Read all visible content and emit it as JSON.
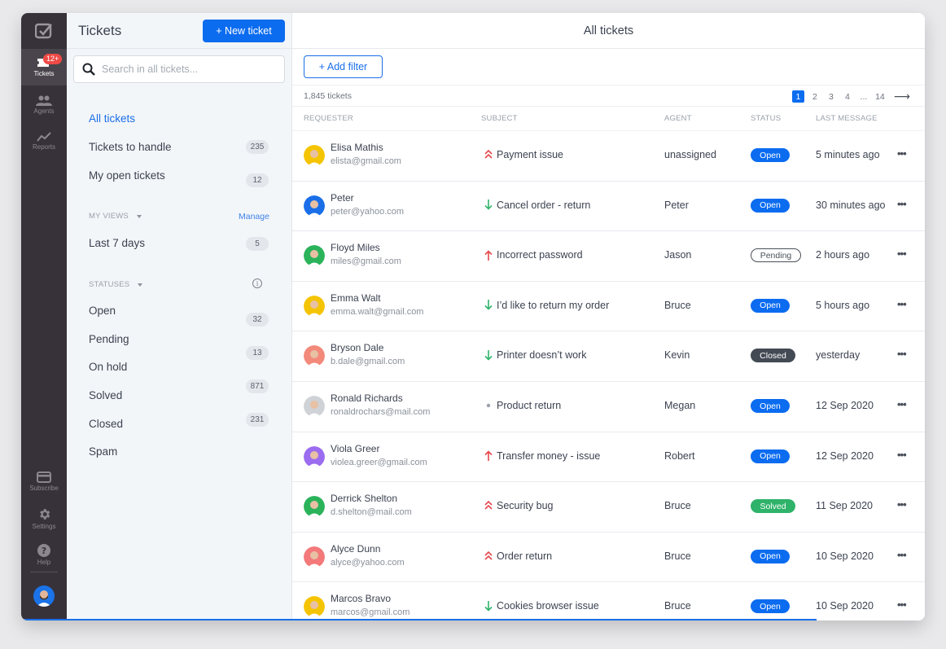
{
  "rail": {
    "items": [
      {
        "name": "tickets",
        "label": "Tickets",
        "icon": "tickets-icon",
        "badge": "12+",
        "active": true
      },
      {
        "name": "agents",
        "label": "Agents",
        "icon": "agents-icon"
      },
      {
        "name": "reports",
        "label": "Reports",
        "icon": "reports-icon"
      },
      {
        "name": "subscribe",
        "label": "Subscribe",
        "icon": "card-icon"
      },
      {
        "name": "settings",
        "label": "Settings",
        "icon": "gear-icon"
      },
      {
        "name": "help",
        "label": "Help",
        "icon": "help-icon"
      }
    ]
  },
  "panel": {
    "title": "Tickets",
    "new_ticket_label": "+ New ticket",
    "search_placeholder": "Search in all tickets...",
    "views": [
      {
        "label": "All tickets",
        "active": true
      },
      {
        "label": "Tickets to handle",
        "count": "235"
      },
      {
        "label": "My open tickets",
        "count": "12"
      }
    ],
    "my_views_label": "MY VIEWS",
    "manage_label": "Manage",
    "my_views": [
      {
        "label": "Last 7 days",
        "count": "5"
      }
    ],
    "statuses_label": "STATUSES",
    "statuses": [
      {
        "label": "Open",
        "count": "32"
      },
      {
        "label": "Pending",
        "count": "13"
      },
      {
        "label": "On hold"
      },
      {
        "label": "Solved",
        "count": "871"
      },
      {
        "label": "Closed",
        "count": "231"
      },
      {
        "label": "Spam"
      }
    ]
  },
  "main": {
    "title": "All tickets",
    "add_filter_label": "+ Add filter",
    "total_label": "1,845 tickets",
    "pagination": {
      "pages": [
        "1",
        "2",
        "3",
        "4",
        "...",
        "14"
      ],
      "current": "1",
      "next_icon": "arrow-right-icon"
    },
    "columns": [
      "REQUESTER",
      "SUBJECT",
      "AGENT",
      "STATUS",
      "LAST MESSAGE"
    ],
    "tickets": [
      {
        "name": "Elisa Mathis",
        "email": "elista@gmail.com",
        "priority": "urgent",
        "subject": "Payment issue",
        "agent": "unassigned",
        "status": "Open",
        "last": "5 minutes ago",
        "avatar_color": "#f5c400"
      },
      {
        "name": "Peter",
        "email": "peter@yahoo.com",
        "priority": "low",
        "subject": "Cancel order - return",
        "agent": "Peter",
        "status": "Open",
        "last": "30 minutes ago",
        "avatar_color": "#1a6fe8"
      },
      {
        "name": "Floyd Miles",
        "email": "miles@gmail.com",
        "priority": "high",
        "subject": "Incorrect password",
        "agent": "Jason",
        "status": "Pending",
        "last": "2 hours ago",
        "avatar_color": "#2bb35a"
      },
      {
        "name": "Emma Walt",
        "email": "emma.walt@gmail.com",
        "priority": "low",
        "subject": "I’d like to return my order",
        "agent": "Bruce",
        "status": "Open",
        "last": "5 hours ago",
        "avatar_color": "#f5c400"
      },
      {
        "name": "Bryson Dale",
        "email": "b.dale@gmail.com",
        "priority": "low",
        "subject": "Printer doesn’t work",
        "agent": "Kevin",
        "status": "Closed",
        "last": "yesterday",
        "avatar_color": "#f3897a"
      },
      {
        "name": "Ronald Richards",
        "email": "ronaldrochars@mail.com",
        "priority": "normal",
        "subject": "Product return",
        "agent": "Megan",
        "status": "Open",
        "last": "12 Sep 2020",
        "avatar_color": "#cfd2d6"
      },
      {
        "name": "Viola Greer",
        "email": "violea.greer@gmail.com",
        "priority": "high",
        "subject": "Transfer money - issue",
        "agent": "Robert",
        "status": "Open",
        "last": "12 Sep 2020",
        "avatar_color": "#9b6cf0"
      },
      {
        "name": "Derrick Shelton",
        "email": "d.shelton@mail.com",
        "priority": "urgent",
        "subject": "Security bug",
        "agent": "Bruce",
        "status": "Solved",
        "last": "11 Sep 2020",
        "avatar_color": "#2bb35a"
      },
      {
        "name": "Alyce Dunn",
        "email": "alyce@yahoo.com",
        "priority": "urgent",
        "subject": "Order return",
        "agent": "Bruce",
        "status": "Open",
        "last": "10 Sep 2020",
        "avatar_color": "#f3797a"
      },
      {
        "name": "Marcos Bravo",
        "email": "marcos@gmail.com",
        "priority": "low",
        "subject": "Cookies browser issue",
        "agent": "Bruce",
        "status": "Open",
        "last": "10 Sep 2020",
        "avatar_color": "#f5c400"
      }
    ],
    "more_icon": "more-horizontal-icon"
  },
  "loading_progress_percent": 88,
  "colors": {
    "accent": "#0b6cf0",
    "rail_bg": "#37323a",
    "badge_red": "#ef4a46",
    "priority_up": "#e5484d",
    "priority_down": "#2fb36a",
    "status_open": "#0b6cf0",
    "status_closed": "#434a54",
    "status_solved": "#2fb36a"
  }
}
